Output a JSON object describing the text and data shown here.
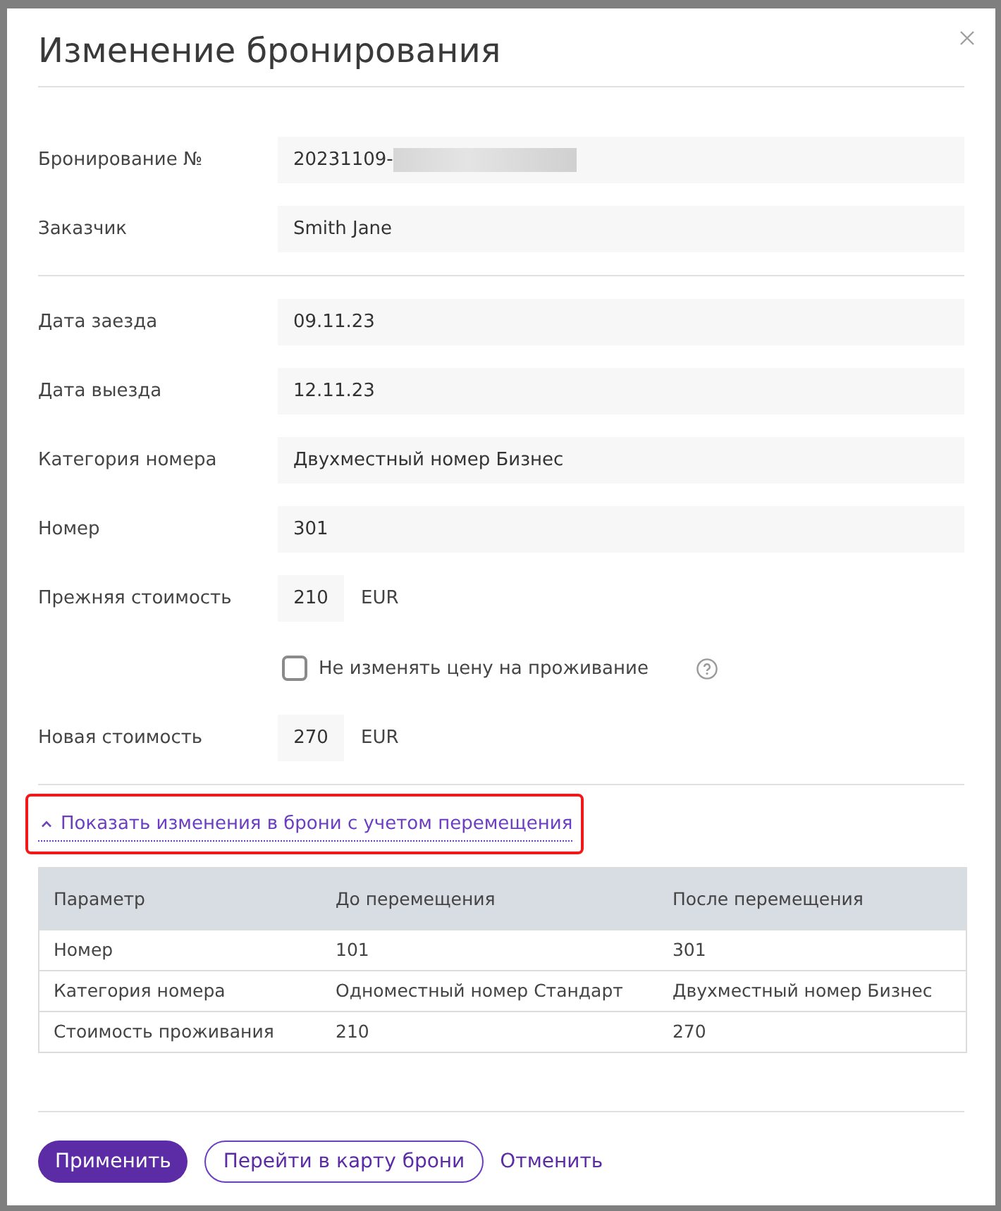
{
  "dialog": {
    "title": "Изменение бронирования"
  },
  "sections": [
    {
      "fields": [
        {
          "kind": "text",
          "label": "Бронирование №",
          "value": "20231109-",
          "redacted": true
        },
        {
          "kind": "text",
          "label": "Заказчик",
          "value": "Smith Jane"
        }
      ]
    },
    {
      "fields": [
        {
          "kind": "text",
          "label": "Дата заезда",
          "value": "09.11.23"
        },
        {
          "kind": "text",
          "label": "Дата выезда",
          "value": "12.11.23"
        },
        {
          "kind": "text",
          "label": "Категория номера",
          "value": "Двухместный номер Бизнес"
        },
        {
          "kind": "text",
          "label": "Номер",
          "value": "301"
        },
        {
          "kind": "price",
          "label": "Прежняя стоимость",
          "value": "210",
          "currency": "EUR"
        },
        {
          "kind": "checkbox",
          "label": "Не изменять цену на проживание",
          "checked": false
        },
        {
          "kind": "price",
          "label": "Новая стоимость",
          "value": "270",
          "currency": "EUR"
        }
      ]
    }
  ],
  "changes_toggle": {
    "label": "Показать изменения в брони с учетом перемещения",
    "expanded": true,
    "highlighted": true
  },
  "table": {
    "columns": [
      "Параметр",
      "До перемещения",
      "После перемещения"
    ],
    "rows": [
      [
        "Номер",
        "101",
        "301"
      ],
      [
        "Категория номера",
        "Одноместный номер Стандарт",
        "Двухместный номер Бизнес"
      ],
      [
        "Стоимость проживания",
        "210",
        "270"
      ]
    ]
  },
  "buttons": [
    {
      "kind": "primary",
      "label": "Применить"
    },
    {
      "kind": "outline",
      "label": "Перейти в карту брони"
    },
    {
      "kind": "link",
      "label": "Отменить"
    }
  ]
}
